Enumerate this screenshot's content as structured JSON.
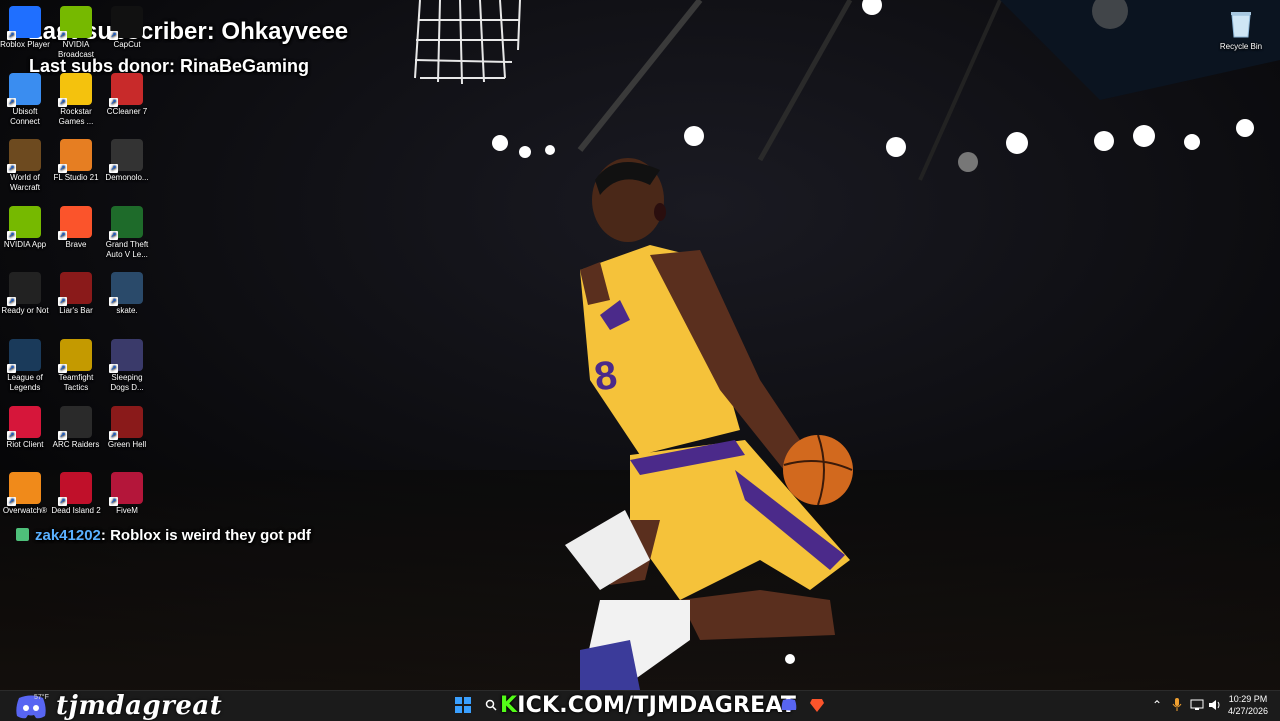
{
  "overlay": {
    "last_subscriber": "Last subscriber: Ohkayveee",
    "last_subs_donor": "Last subs donor: RinaBeGaming"
  },
  "chat": {
    "username": "zak41202",
    "message": ": Roblox is weird they got pdf"
  },
  "desktop_icons": [
    {
      "label": "Roblox Player",
      "icon": "roblox-icon"
    },
    {
      "label": "NVIDIA Broadcast",
      "icon": "nvidia-broadcast-icon"
    },
    {
      "label": "CapCut",
      "icon": "capcut-icon"
    },
    {
      "label": "Ubisoft Connect",
      "icon": "ubisoft-icon"
    },
    {
      "label": "Rockstar Games ...",
      "icon": "rockstar-icon"
    },
    {
      "label": "CCleaner 7",
      "icon": "ccleaner-icon"
    },
    {
      "label": "World of Warcraft",
      "icon": "wow-icon"
    },
    {
      "label": "FL Studio 21",
      "icon": "fl-studio-icon"
    },
    {
      "label": "Demonolo...",
      "icon": "demonologist-icon"
    },
    {
      "label": "NVIDIA App",
      "icon": "nvidia-app-icon"
    },
    {
      "label": "Brave",
      "icon": "brave-icon"
    },
    {
      "label": "Grand Theft Auto V Le...",
      "icon": "gta-v-icon"
    },
    {
      "label": "Ready or Not",
      "icon": "ready-or-not-icon"
    },
    {
      "label": "Liar's Bar",
      "icon": "liars-bar-icon"
    },
    {
      "label": "skate.",
      "icon": "skate-icon"
    },
    {
      "label": "League of Legends",
      "icon": "league-icon"
    },
    {
      "label": "Teamfight Tactics",
      "icon": "tft-icon"
    },
    {
      "label": "Sleeping Dogs D...",
      "icon": "sleeping-dogs-icon"
    },
    {
      "label": "Riot Client",
      "icon": "riot-client-icon"
    },
    {
      "label": "ARC Raiders",
      "icon": "arc-raiders-icon"
    },
    {
      "label": "Green Hell",
      "icon": "green-hell-icon"
    },
    {
      "label": "Overwatch®",
      "icon": "overwatch-icon"
    },
    {
      "label": "Dead Island 2",
      "icon": "dead-island-icon"
    },
    {
      "label": "FiveM",
      "icon": "fivem-icon"
    }
  ],
  "recycle_bin": {
    "label": "Recycle Bin"
  },
  "taskbar": {
    "streamer_name": "tjmdagreat",
    "kick_prefix": "K",
    "kick_rest": "ICK.COM/TJMDAGREAT",
    "weather_temp": "57°F",
    "time": "10:29 PM",
    "date": "4/27/2026"
  },
  "colors": {
    "accent_kick": "#53fc18",
    "chat_username": "#5ab0ff",
    "jersey_gold": "#f5c23a",
    "jersey_purple": "#4b2a8a"
  }
}
